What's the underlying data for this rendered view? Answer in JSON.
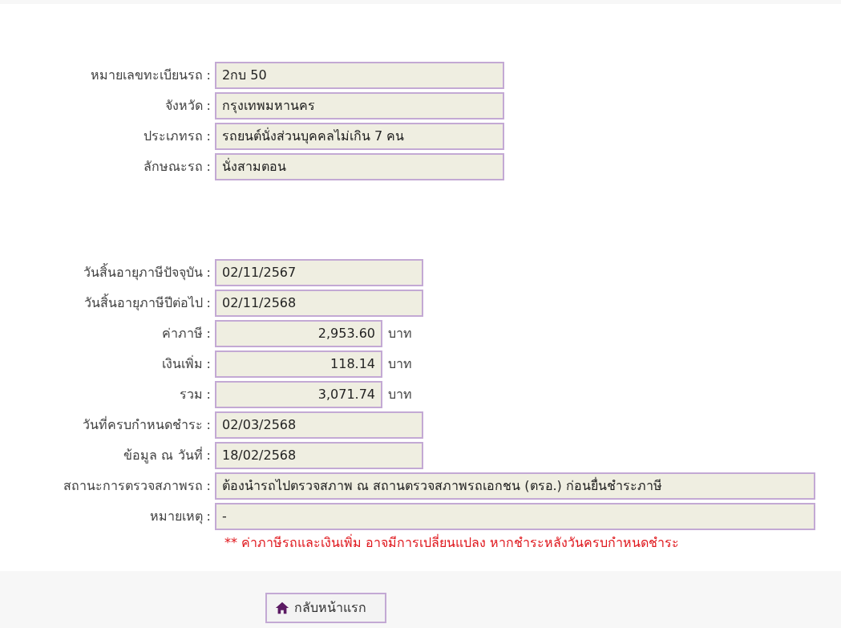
{
  "vehicle": [
    {
      "label": "หมายเลขทะเบียนรถ :",
      "value": "2กบ 50",
      "kind": "text"
    },
    {
      "label": "จังหวัด :",
      "value": "กรุงเทพมหานคร",
      "kind": "text"
    },
    {
      "label": "ประเภทรถ :",
      "value": "รถยนต์นั่งส่วนบุคคลไม่เกิน 7 คน",
      "kind": "text"
    },
    {
      "label": "ลักษณะรถ :",
      "value": "นั่งสามตอน",
      "kind": "text"
    }
  ],
  "tax": [
    {
      "label": "วันสิ้นอายุภาษีปัจจุบัน :",
      "value": "02/11/2567",
      "kind": "date"
    },
    {
      "label": "วันสิ้นอายุภาษีปีต่อไป :",
      "value": "02/11/2568",
      "kind": "date"
    },
    {
      "label": "ค่าภาษี :",
      "value": "2,953.60",
      "kind": "amount",
      "unit": "บาท"
    },
    {
      "label": "เงินเพิ่ม :",
      "value": "118.14",
      "kind": "amount",
      "unit": "บาท"
    },
    {
      "label": "รวม :",
      "value": "3,071.74",
      "kind": "amount",
      "unit": "บาท"
    },
    {
      "label": "วันที่ครบกำหนดชำระ :",
      "value": "02/03/2568",
      "kind": "date"
    },
    {
      "label": "ข้อมูล ณ วันที่ :",
      "value": "18/02/2568",
      "kind": "date"
    },
    {
      "label": "สถานะการตรวจสภาพรถ :",
      "value": "ต้องนำรถไปตรวจสภาพ ณ สถานตรวจสภาพรถเอกชน (ตรอ.) ก่อนยื่นชำระภาษี",
      "kind": "wide"
    },
    {
      "label": "หมายเหตุ :",
      "value": "-",
      "kind": "wide"
    }
  ],
  "warning": "** ค่าภาษีรถและเงินเพิ่ม อาจมีการเปลี่ยนแปลง หากชำระหลังวันครบกำหนดชำระ",
  "home_button": "กลับหน้าแรก"
}
